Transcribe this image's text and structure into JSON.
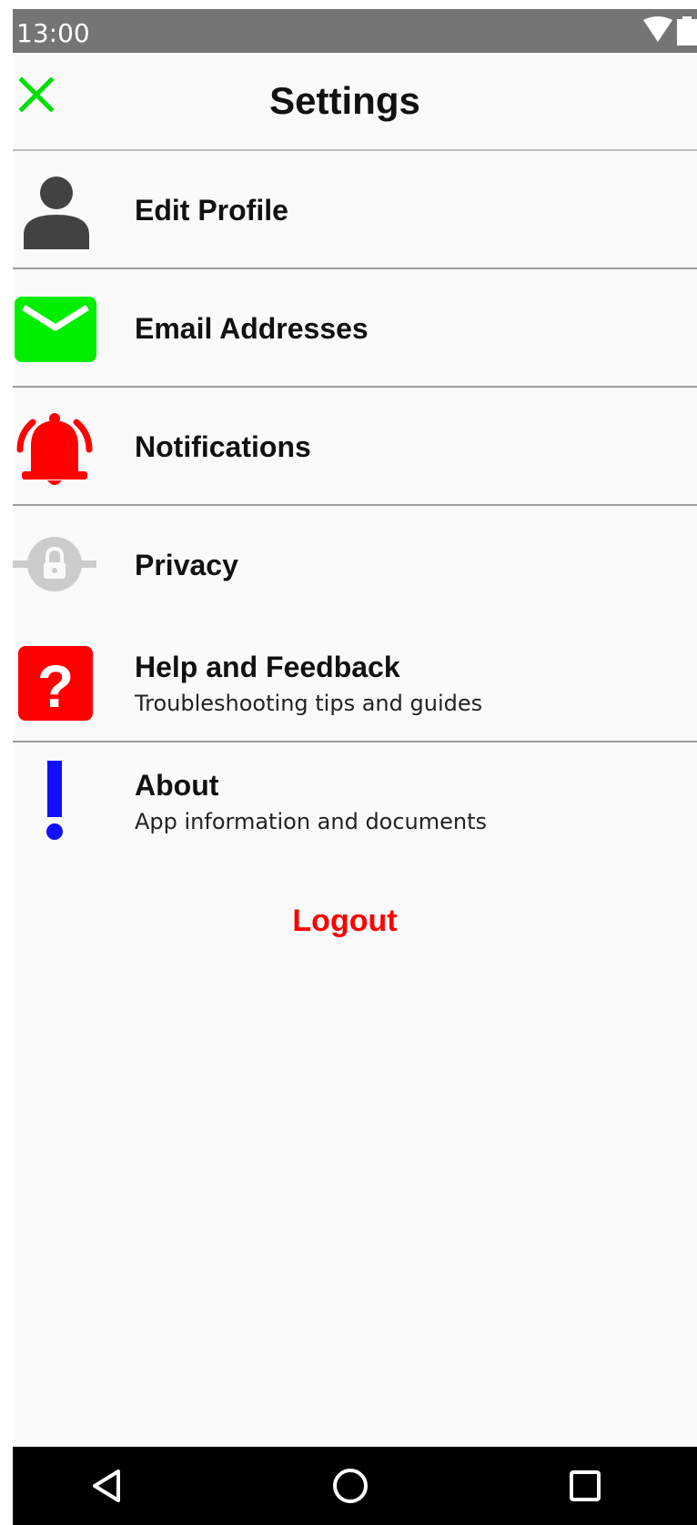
{
  "status_bar": {
    "time": "13:00",
    "icons": [
      "wifi-icon",
      "battery-icon"
    ]
  },
  "header": {
    "title": "Settings",
    "close_icon": "close-icon",
    "accent_color": "#00e000"
  },
  "settings_items": [
    {
      "label": "Edit Profile",
      "icon": "person-icon",
      "color": "#424242"
    },
    {
      "label": "Email Addresses",
      "icon": "envelope-icon",
      "color": "#00ee00"
    },
    {
      "label": "Notifications",
      "icon": "bell-icon",
      "color": "#ff0000"
    },
    {
      "label": "Privacy",
      "icon": "lock-icon",
      "color": "#cccccc"
    },
    {
      "label": "Help and Feedback",
      "subtitle": "Troubleshooting tips and guides",
      "icon": "question-icon",
      "color": "#ff0000"
    },
    {
      "label": "About",
      "subtitle": "App information and documents",
      "icon": "exclamation-icon",
      "color": "#1111ff"
    }
  ],
  "logout": {
    "label": "Logout",
    "color": "#ff0000"
  },
  "nav_bar": {
    "icons": [
      "back-icon",
      "home-icon",
      "recents-icon"
    ]
  }
}
